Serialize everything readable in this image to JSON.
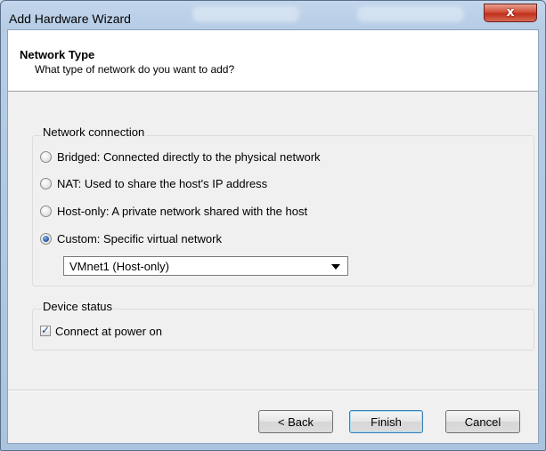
{
  "window": {
    "title": "Add Hardware Wizard",
    "close_label": "x"
  },
  "header": {
    "title": "Network Type",
    "subtitle": "What type of network do you want to add?"
  },
  "network_connection": {
    "legend": "Network connection",
    "options": [
      {
        "label": "Bridged: Connected directly to the physical network",
        "selected": false
      },
      {
        "label": "NAT: Used to share the host's IP address",
        "selected": false
      },
      {
        "label": "Host-only: A private network shared with the host",
        "selected": false
      },
      {
        "label": "Custom: Specific virtual network",
        "selected": true
      }
    ],
    "custom_network": {
      "selected_value": "VMnet1 (Host-only)"
    }
  },
  "device_status": {
    "legend": "Device status",
    "connect_at_power_on": {
      "label": "Connect at power on",
      "checked": true
    }
  },
  "buttons": {
    "back": "< Back",
    "finish": "Finish",
    "cancel": "Cancel"
  },
  "colors": {
    "window_frame": "#b7cde6",
    "client_bg": "#f0f0f0",
    "close_button": "#c0301c",
    "accent": "#2a5ea8"
  }
}
